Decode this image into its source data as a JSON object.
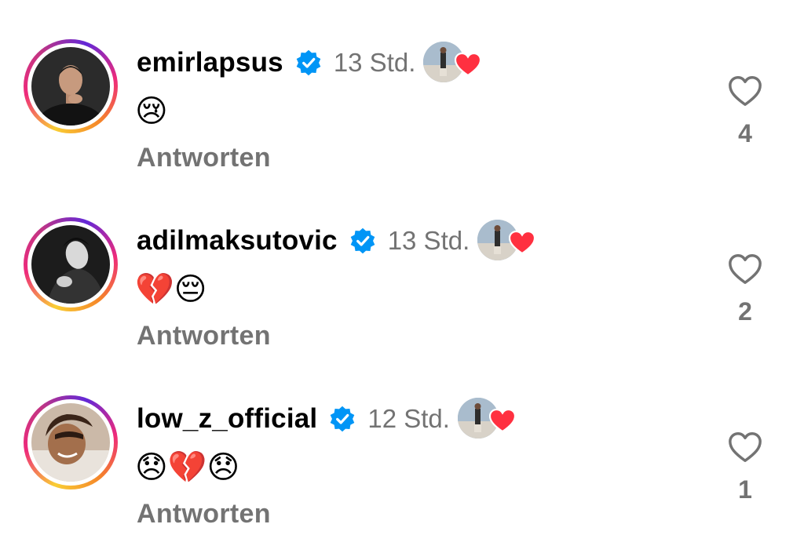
{
  "comments": [
    {
      "username": "emirlapsus",
      "verified": true,
      "time": "13 Std.",
      "text": "😢",
      "reply_label": "Antworten",
      "like_count": "4",
      "avatar_bg": "#2b2b2b",
      "avatar_skin": "#c79a7e",
      "avatar_shirt": "#121212"
    },
    {
      "username": "adilmaksutovic",
      "verified": true,
      "time": "13 Std.",
      "text": "💔😔",
      "reply_label": "Antworten",
      "like_count": "2",
      "avatar_bg": "#1c1c1c",
      "avatar_skin": "#d9d9d9",
      "avatar_shirt": "#333333"
    },
    {
      "username": "low_z_official",
      "verified": true,
      "time": "12 Std.",
      "text": "😞💔😞",
      "reply_label": "Antworten",
      "like_count": "1",
      "avatar_bg": "#cbb9a8",
      "avatar_skin": "#a36f4c",
      "avatar_shirt": "#e9e3dc"
    }
  ],
  "colors": {
    "verified_badge": "#0095f6",
    "liked_heart": "#ff3040",
    "secondary_text": "#737373",
    "story_ring_start": "#f9ce34",
    "story_ring_mid": "#ee2a7b",
    "story_ring_end": "#6228d7"
  },
  "icons": {
    "verified": "verified-badge-icon",
    "creator_liked": "heart-filled-icon",
    "like": "heart-outline-icon"
  }
}
